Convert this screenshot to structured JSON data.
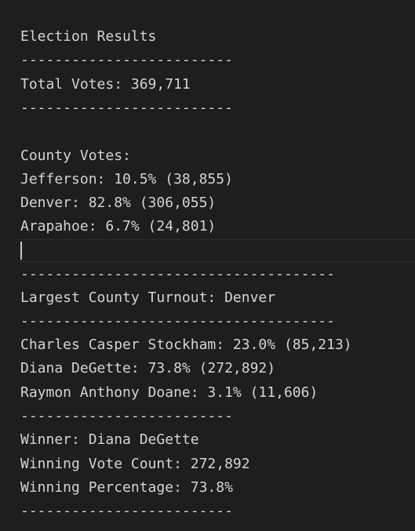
{
  "output": {
    "title": "Election Results",
    "sep_short": "-------------------------",
    "sep_long": "-------------------------------------",
    "total_votes": "Total Votes: 369,711",
    "county_header": "County Votes:",
    "county_lines": [
      "Jefferson: 10.5% (38,855)",
      "Denver: 82.8% (306,055)",
      "Arapahoe: 6.7% (24,801)"
    ],
    "largest_county": "Largest County Turnout: Denver",
    "candidate_lines": [
      "Charles Casper Stockham: 23.0% (85,213)",
      "Diana DeGette: 73.8% (272,892)",
      "Raymon Anthony Doane: 3.1% (11,606)"
    ],
    "winner": "Winner: Diana DeGette",
    "winning_count": "Winning Vote Count: 272,892",
    "winning_percentage": "Winning Percentage: 73.8%"
  }
}
